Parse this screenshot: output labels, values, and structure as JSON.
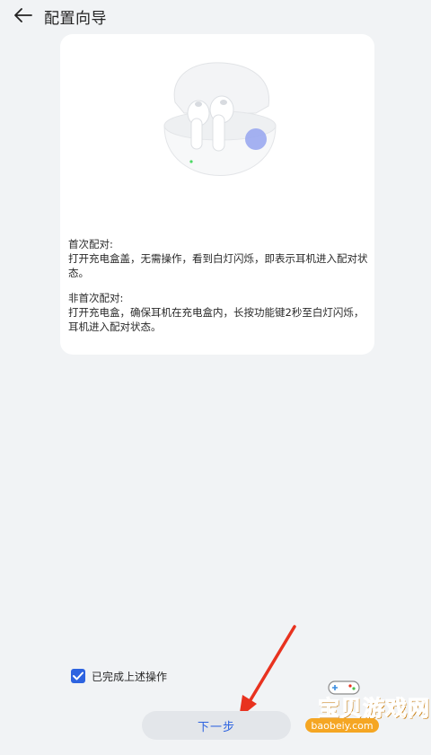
{
  "header": {
    "title": "配置向导"
  },
  "instructions": {
    "first_pair_heading": "首次配对:",
    "first_pair_text": "打开充电盒盖，无需操作，看到白灯闪烁，即表示耳机进入配对状态。",
    "repeat_pair_heading": "非首次配对:",
    "repeat_pair_text": "打开充电盒，确保耳机在充电盒内，长按功能键2秒至白灯闪烁，耳机进入配对状态。"
  },
  "confirm": {
    "checked": true,
    "label": "已完成上述操作"
  },
  "footer": {
    "next_label": "下一步"
  },
  "watermark": {
    "brand": "宝贝游戏网",
    "url": "baobeiy.com"
  },
  "colors": {
    "accent": "#2d63e0",
    "annotation_arrow": "#e8321f",
    "indicator_light": "#9aa8f0"
  }
}
